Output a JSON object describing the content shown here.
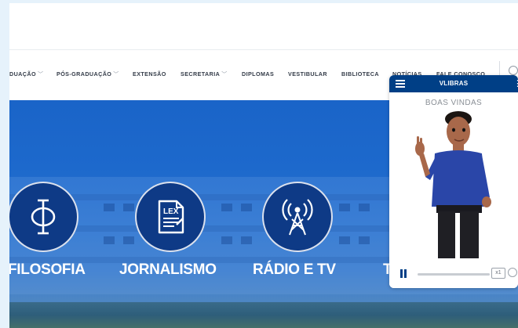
{
  "nav": {
    "items": [
      {
        "label": "DUAÇÃO",
        "dropdown": true
      },
      {
        "label": "PÓS-GRADUAÇÃO",
        "dropdown": true
      },
      {
        "label": "EXTENSÃO",
        "dropdown": false
      },
      {
        "label": "SECRETARIA",
        "dropdown": true
      },
      {
        "label": "DIPLOMAS",
        "dropdown": false
      },
      {
        "label": "VESTIBULAR",
        "dropdown": false
      },
      {
        "label": "BIBLIOTECA",
        "dropdown": false
      },
      {
        "label": "NOTÍCIAS",
        "dropdown": false
      },
      {
        "label": "FALE CONOSCO",
        "dropdown": false
      }
    ],
    "search_icon": "search-icon"
  },
  "hero": {
    "courses": [
      {
        "label": "FILOSOFIA",
        "icon": "phi-icon"
      },
      {
        "label": "JORNALISMO",
        "icon": "lex-document-icon",
        "icon_text": "LEX"
      },
      {
        "label": "RÁDIO E TV",
        "icon": "radio-tower-icon"
      },
      {
        "label": "T",
        "icon": ""
      }
    ]
  },
  "vlibras": {
    "title": "VLIBRAS",
    "subtitle": "BOAS VINDAS",
    "speed_label": "x1",
    "menu_icon": "hamburger-menu-icon",
    "pause_icon": "pause-icon",
    "subtitles_icon": "subtitles-icon",
    "colors": {
      "header": "#003f86",
      "accent": "#003f86"
    }
  },
  "colors": {
    "hero_blue": "#1a64c8",
    "course_circle": "#0e3a86",
    "nav_text": "#333b48"
  }
}
